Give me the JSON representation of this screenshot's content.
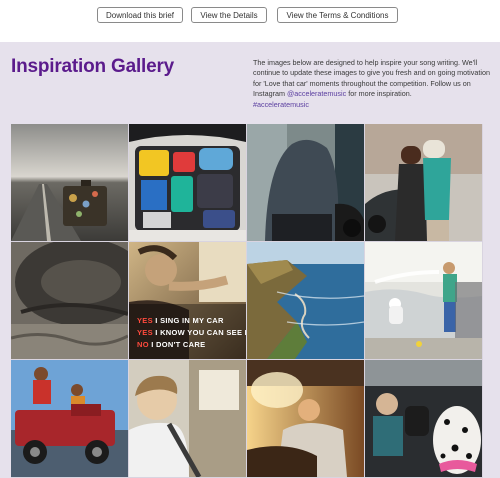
{
  "buttons": {
    "brief": "Download this brief",
    "details": "View the Details",
    "terms": "View the Terms & Conditions"
  },
  "gallery": {
    "title": "Inspiration Gallery",
    "intro_text": "The images below are designed to help inspire your song writing. We'll continue to update these images to give you fresh and on going motivation for 'Love that car' moments throughout the competition. Follow us on Instagram",
    "instagram_handle": "@acceleratemusic",
    "intro_suffix": "for more inspiration.",
    "hashtag": "#acceleratemusic"
  },
  "tiles": [
    {
      "id": "road-luggage",
      "icon": "suitcase-on-road"
    },
    {
      "id": "packed-trunk",
      "icon": "car-boot"
    },
    {
      "id": "person-leaning-car",
      "icon": "person"
    },
    {
      "id": "couple-kissing",
      "icon": "couple"
    },
    {
      "id": "worn-tire",
      "icon": "tire"
    },
    {
      "id": "singing-in-car",
      "icon": "singer"
    },
    {
      "id": "coastal-road",
      "icon": "coastline"
    },
    {
      "id": "washing-car",
      "icon": "hose"
    },
    {
      "id": "jeep-friends",
      "icon": "jeep"
    },
    {
      "id": "child-in-car",
      "icon": "child"
    },
    {
      "id": "sleeping-in-car",
      "icon": "sleeper"
    },
    {
      "id": "dog-in-car",
      "icon": "dalmatian"
    }
  ],
  "overlay_lines": [
    {
      "prefix": "YES",
      "rest": " I SING IN MY CAR"
    },
    {
      "prefix": "YES",
      "rest": " I KNOW YOU CAN SEE ME"
    },
    {
      "prefix": "NO",
      "rest": " I DON'T CARE"
    }
  ],
  "colors": {
    "title_purple": "#5b1b8c",
    "section_bg": "#e6e1ec",
    "link_purple": "#5b3fa0",
    "overlay_red": "#ff4a3d"
  }
}
